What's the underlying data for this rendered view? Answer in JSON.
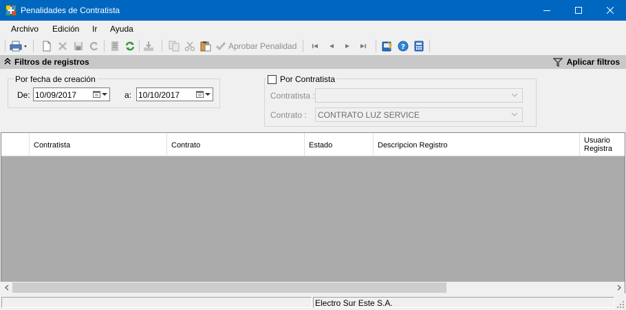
{
  "window": {
    "title": "Penalidades de Contratista",
    "minimize_icon": "minimize-icon",
    "maximize_icon": "maximize-icon",
    "close_icon": "close-icon"
  },
  "menu": {
    "items": [
      "Archivo",
      "Edición",
      "Ir",
      "Ayuda"
    ]
  },
  "toolbar": {
    "aprobar_label": "Aprobar Penalidad",
    "icons": [
      "printer-icon",
      "new-document-icon",
      "delete-icon",
      "save-icon",
      "undo-icon",
      "list-icon",
      "refresh-icon",
      "export-icon",
      "copy-icon",
      "cut-icon",
      "paste-icon",
      "check-icon",
      "first-record-icon",
      "previous-record-icon",
      "next-record-icon",
      "last-record-icon",
      "book-icon",
      "help-icon",
      "calculator-icon"
    ]
  },
  "filters": {
    "title": "Filtros de registros",
    "apply_label": "Aplicar filtros",
    "date_group": {
      "label": "Por fecha de creación",
      "from_label": "De:",
      "from_value": "10/09/2017",
      "to_label": "a:",
      "to_value": "10/10/2017"
    },
    "contractor_group": {
      "label": "Por Contratista",
      "checked": false,
      "contratista_label": "Contratista :",
      "contratista_value": "",
      "contrato_label": "Contrato :",
      "contrato_value": "CONTRATO LUZ SERVICE"
    }
  },
  "grid": {
    "columns": [
      "Contratista",
      "Contrato",
      "Estado",
      "Descripcion Registro",
      "Usuario Registra"
    ],
    "usuario_line1": "Usuario",
    "usuario_line2": "Registra",
    "rows": []
  },
  "status": {
    "company": "Electro Sur Este S.A."
  },
  "colors": {
    "titlebar": "#0067c0",
    "filters_header": "#c8c8c8",
    "grid_background": "#ababab"
  }
}
